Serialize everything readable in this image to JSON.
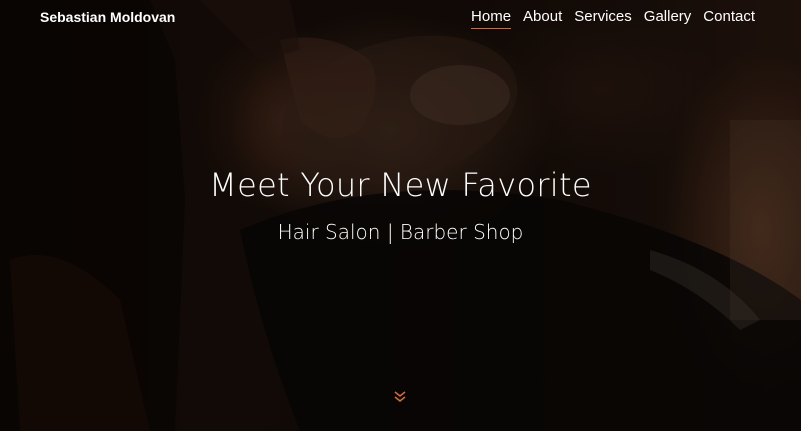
{
  "brand": {
    "name": "Sebastian Moldovan"
  },
  "nav": {
    "items": [
      {
        "label": "Home",
        "active": true
      },
      {
        "label": "About",
        "active": false
      },
      {
        "label": "Services",
        "active": false
      },
      {
        "label": "Gallery",
        "active": false
      },
      {
        "label": "Contact",
        "active": false
      }
    ]
  },
  "hero": {
    "title": "Meet Your New Favorite",
    "subtitle": "Hair Salon | Barber Shop",
    "scroll_icon": "double-chevron-down-icon"
  },
  "colors": {
    "accent": "#d26a3a",
    "text": "#ffffff",
    "background": "#0d0806"
  }
}
